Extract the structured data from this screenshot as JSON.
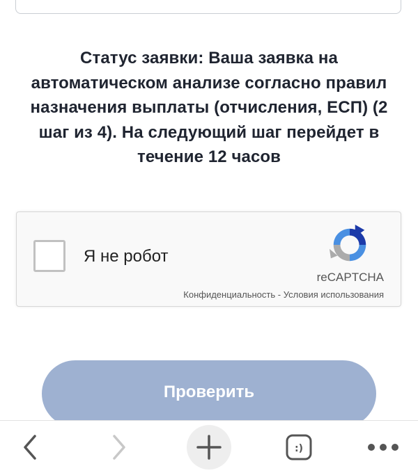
{
  "status": {
    "text": "Статус заявки: Ваша заявка на автоматическом анализе согласно правил назначения выплаты (отчисления, ЕСП) (2 шаг из 4). На следующий шаг перейдет в течение 12 часов"
  },
  "captcha": {
    "label": "Я не робот",
    "brand": "reCAPTCHA",
    "privacy": "Конфиденциальность",
    "separator": " - ",
    "terms": "Условия использования",
    "checked": false
  },
  "main": {
    "check_button_label": "Проверить"
  },
  "browser_bar": {
    "tabs_glyph": ":)",
    "icons": [
      "back-arrow-icon",
      "forward-arrow-icon",
      "plus-icon",
      "tabs-icon",
      "more-icon"
    ],
    "colors": {
      "active_icon": "#555555",
      "disabled_icon": "#c8c8c8"
    }
  },
  "colors": {
    "button_bg": "#9eb1d1",
    "status_text": "#1f2430"
  }
}
